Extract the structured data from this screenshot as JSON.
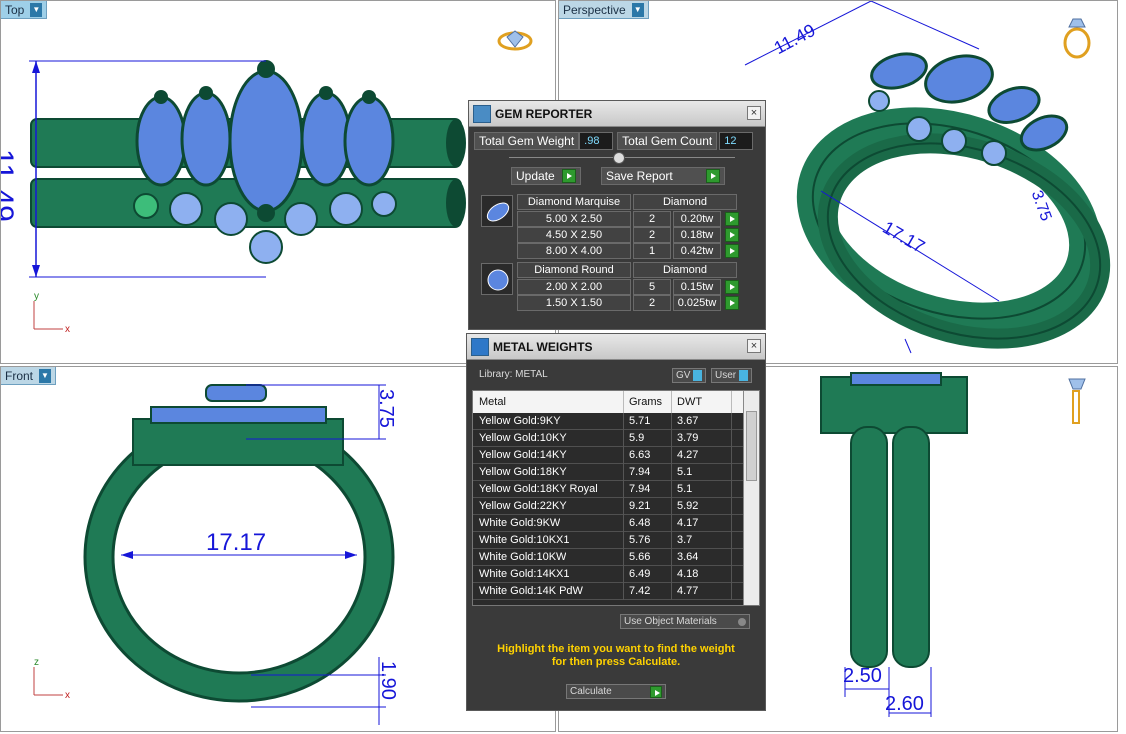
{
  "viewports": {
    "top": {
      "label": "Top",
      "dim_height": "11.49"
    },
    "perspective": {
      "label": "Perspective",
      "dim_a": "11.49",
      "dim_b": "17.17",
      "dim_c": "3.75"
    },
    "front": {
      "label": "Front",
      "dim_width": "17.17",
      "dim_height": "3.75",
      "dim_band": "1.90"
    },
    "right": {
      "dim_a": "2.50",
      "dim_b": "2.60"
    }
  },
  "gem_reporter": {
    "title": "GEM REPORTER",
    "total_weight_label": "Total Gem Weight",
    "total_weight_value": ".98",
    "total_count_label": "Total Gem Count",
    "total_count_value": "12",
    "update_label": "Update",
    "save_report_label": "Save Report",
    "groups": [
      {
        "shape": "Diamond Marquise",
        "material": "Diamond",
        "rows": [
          {
            "size": "5.00 X 2.50",
            "count": "2",
            "weight": "0.20tw"
          },
          {
            "size": "4.50 X 2.50",
            "count": "2",
            "weight": "0.18tw"
          },
          {
            "size": "8.00 X 4.00",
            "count": "1",
            "weight": "0.42tw"
          }
        ]
      },
      {
        "shape": "Diamond Round",
        "material": "Diamond",
        "rows": [
          {
            "size": "2.00 X 2.00",
            "count": "5",
            "weight": "0.15tw"
          },
          {
            "size": "1.50 X 1.50",
            "count": "2",
            "weight": "0.025tw"
          }
        ]
      }
    ]
  },
  "metal_weights": {
    "title": "METAL WEIGHTS",
    "library_label": "Library: METAL",
    "gv_label": "GV",
    "user_label": "User",
    "columns": [
      "Metal",
      "Grams",
      "DWT"
    ],
    "rows": [
      {
        "metal": "Yellow Gold:9KY",
        "grams": "5.71",
        "dwt": "3.67"
      },
      {
        "metal": "Yellow Gold:10KY",
        "grams": "5.9",
        "dwt": "3.79"
      },
      {
        "metal": "Yellow Gold:14KY",
        "grams": "6.63",
        "dwt": "4.27"
      },
      {
        "metal": "Yellow Gold:18KY",
        "grams": "7.94",
        "dwt": "5.1"
      },
      {
        "metal": "Yellow Gold:18KY Royal",
        "grams": "7.94",
        "dwt": "5.1"
      },
      {
        "metal": "Yellow Gold:22KY",
        "grams": "9.21",
        "dwt": "5.92"
      },
      {
        "metal": "White Gold:9KW",
        "grams": "6.48",
        "dwt": "4.17"
      },
      {
        "metal": "White Gold:10KX1",
        "grams": "5.76",
        "dwt": "3.7"
      },
      {
        "metal": "White Gold:10KW",
        "grams": "5.66",
        "dwt": "3.64"
      },
      {
        "metal": "White Gold:14KX1",
        "grams": "6.49",
        "dwt": "4.18"
      },
      {
        "metal": "White Gold:14K PdW",
        "grams": "7.42",
        "dwt": "4.77"
      }
    ],
    "use_object_materials_label": "Use Object Materials",
    "hint_line1": "Highlight the item you want to find the weight",
    "hint_line2": "for then press Calculate.",
    "calculate_label": "Calculate"
  },
  "colors": {
    "metal": "#1f7a55",
    "metal_dark": "#0d4a33",
    "gem": "#5b86df",
    "dimension": "#1616d8",
    "panel_bg": "#3a3a3a"
  }
}
